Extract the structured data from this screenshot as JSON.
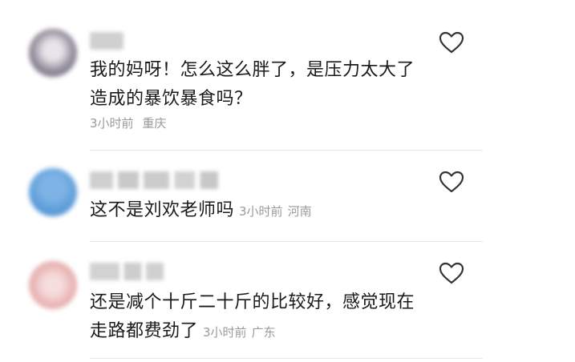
{
  "comments": [
    {
      "text": "我的妈呀！怎么这么胖了，是压力太大了造成的暴饮暴食吗？",
      "time": "3小时前",
      "location": "重庆",
      "avatar_color": "#8d8797",
      "name_color": "#c8c8c8"
    },
    {
      "text": "这不是刘欢老师吗",
      "time": "3小时前",
      "location": "河南",
      "avatar_color": "#5b9bd8",
      "name_color": "#c4c4c4"
    },
    {
      "text": "还是减个十斤二十斤的比较好，感觉现在走路都费劲了",
      "time": "3小时前",
      "location": "广东",
      "avatar_color": "#e9b4b4",
      "name_color": "#cfcfcf"
    }
  ],
  "icons": {
    "like": "heart-outline-icon"
  }
}
